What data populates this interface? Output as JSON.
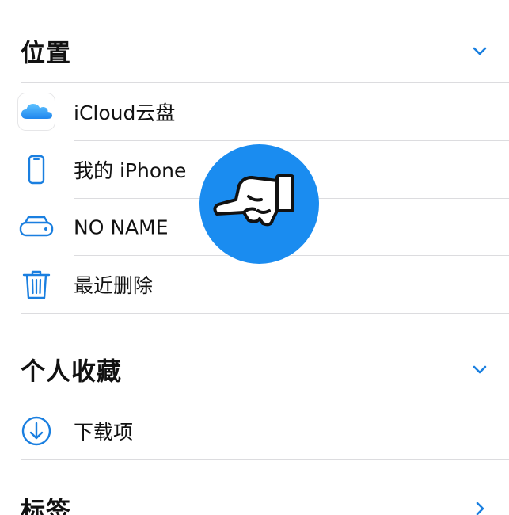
{
  "sections": {
    "locations": {
      "title": "位置",
      "items": [
        {
          "label": "iCloud云盘",
          "icon": "icloud-icon"
        },
        {
          "label": "我的 iPhone",
          "icon": "iphone-icon"
        },
        {
          "label": "NO NAME",
          "icon": "drive-icon"
        },
        {
          "label": "最近删除",
          "icon": "trash-icon"
        }
      ]
    },
    "favorites": {
      "title": "个人收藏",
      "items": [
        {
          "label": "下载项",
          "icon": "download-icon"
        }
      ]
    },
    "tags": {
      "title": "标签"
    }
  },
  "colors": {
    "accent": "#1a7fe0",
    "overlay": "#1a8cf0",
    "divider": "#dcdcdf"
  }
}
